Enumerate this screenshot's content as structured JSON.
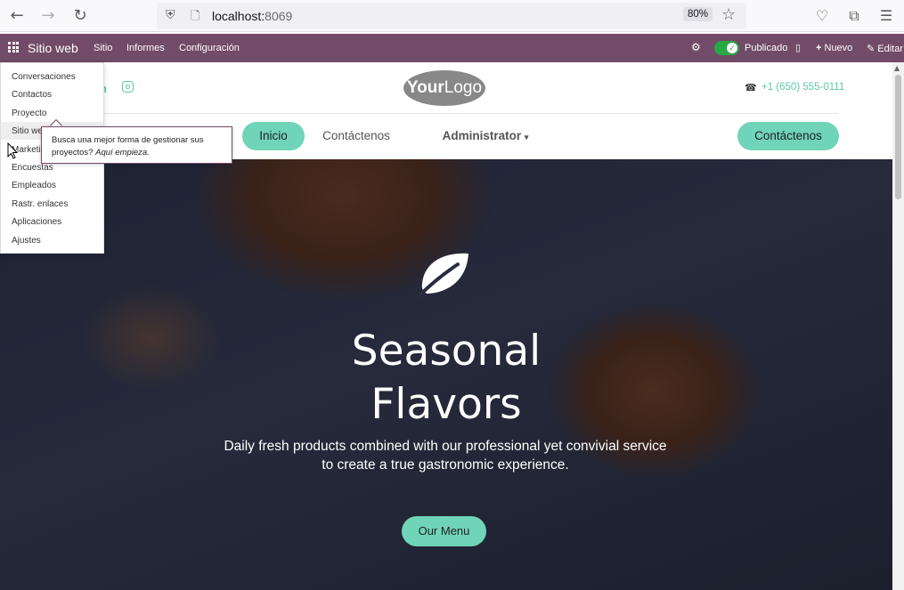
{
  "browser": {
    "url_host": "localhost:",
    "url_port": "8069",
    "zoom": "80%"
  },
  "odoo_bar": {
    "app_name": "Sitio web",
    "menus": [
      "Sitio",
      "Informes",
      "Configuración"
    ],
    "published_label": "Publicado",
    "new_label": "Nuevo",
    "edit_label": "Editar"
  },
  "dropdown": {
    "items": [
      "Conversaciones",
      "Contactos",
      "Proyecto",
      "Sitio web",
      "Marketing",
      "Encuestas",
      "Empleados",
      "Rastr. enlaces",
      "Aplicaciones",
      "Ajustes"
    ],
    "visible_labels": [
      "Conversaciones",
      "Contactos",
      "Proyecto",
      "Sitio we",
      "Marketi",
      "Encuestas",
      "Empleados",
      "Rastr. enlaces",
      "Aplicaciones",
      "Ajustes"
    ]
  },
  "tooltip": {
    "line1": "Busca una mejor forma de gestionar sus",
    "line2_prefix": "proyectos? ",
    "line2_emph": "Aquí empieza."
  },
  "website": {
    "social_text": "n",
    "logo_your": "Your",
    "logo_logo": "Logo",
    "phone": "+1 (650) 555-0111",
    "nav": {
      "home": "Inicio",
      "contact": "Contáctenos",
      "admin": "Administrator",
      "cta": "Contáctenos"
    },
    "hero": {
      "title_line1": "Seasonal",
      "title_line2": "Flavors",
      "subtitle_line1": "Daily fresh products combined with our professional yet convivial service",
      "subtitle_line2": "to create a true gastronomic experience.",
      "button": "Our Menu"
    }
  },
  "colors": {
    "odoo_purple": "#714b67",
    "accent_teal": "#6fd4b8",
    "teal_text": "#5cc7a8",
    "published_green": "#28a745"
  }
}
